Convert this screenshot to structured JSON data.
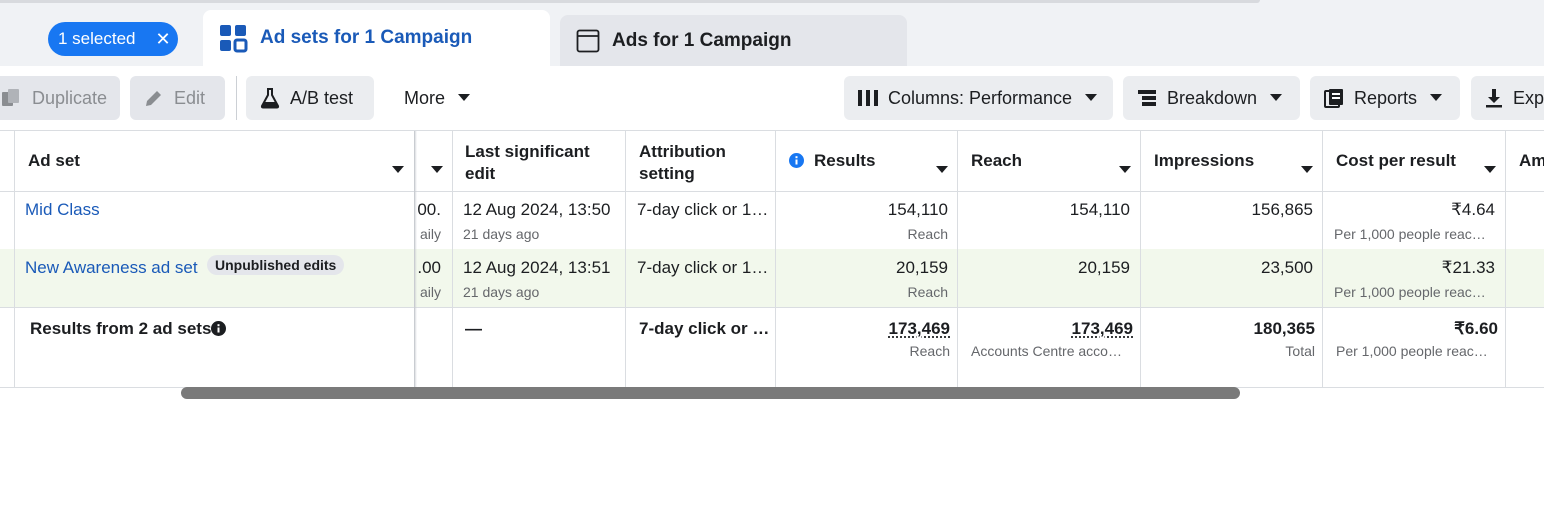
{
  "tabs": {
    "selected_pill": {
      "label": "1 selected",
      "close": "✕"
    },
    "adsets_tab": "Ad sets for 1 Campaign",
    "ads_tab": "Ads for 1 Campaign"
  },
  "toolbar": {
    "duplicate": "Duplicate",
    "edit": "Edit",
    "ab_test": "A/B test",
    "more": "More",
    "columns": "Columns: Performance",
    "breakdown": "Breakdown",
    "reports": "Reports",
    "export": "Exp"
  },
  "table": {
    "headers": {
      "ad_set": "Ad set",
      "last_edit": "Last significant edit",
      "attribution": "Attribution setting",
      "results": "Results",
      "reach": "Reach",
      "impressions": "Impressions",
      "cost_per_result": "Cost per result",
      "amount": "Am"
    },
    "rows": [
      {
        "name": "Mid Class",
        "budget": ".00",
        "budget_sub": "aily",
        "last_edit": "12 Aug 2024, 13:50",
        "last_edit_sub": "21 days ago",
        "attribution": "7-day click or 1…",
        "results": "154,110",
        "results_sub": "Reach",
        "reach": "154,110",
        "impressions": "156,865",
        "cost": "₹4.64",
        "cost_sub": "Per 1,000 people reac…"
      },
      {
        "name": "New Awareness ad set",
        "badge": "Unpublished edits",
        "budget": ".00",
        "budget_sub": "aily",
        "last_edit": "12 Aug 2024, 13:51",
        "last_edit_sub": "21 days ago",
        "attribution": "7-day click or 1…",
        "results": "20,159",
        "results_sub": "Reach",
        "reach": "20,159",
        "impressions": "23,500",
        "cost": "₹21.33",
        "cost_sub": "Per 1,000 people reac…"
      }
    ],
    "totals": {
      "label": "Results from 2 ad sets",
      "last_edit": "—",
      "attribution": "7-day click or …",
      "results": "173,469",
      "results_sub": "Reach",
      "reach": "173,469",
      "reach_sub": "Accounts Centre acco…",
      "impressions": "180,365",
      "impressions_sub": "Total",
      "cost": "₹6.60",
      "cost_sub": "Per 1,000 people reac…"
    }
  },
  "colors": {
    "accent": "#1877f2",
    "link": "#1a5ab8",
    "selected_row": "#f2f8ec"
  },
  "icons": [
    "close-icon",
    "grid-icon",
    "window-icon",
    "duplicate-icon",
    "pencil-icon",
    "flask-icon",
    "caret-down-icon",
    "columns-icon",
    "breakdown-icon",
    "reports-icon",
    "download-icon",
    "info-icon"
  ]
}
